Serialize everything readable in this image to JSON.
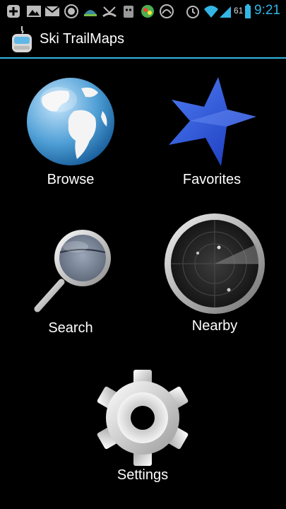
{
  "status_bar": {
    "notifications": [
      "add-icon",
      "image-icon",
      "gmail-icon",
      "sync-icon",
      "weather-icon",
      "missed-call-icon",
      "android-icon",
      "game-icon",
      "speed-icon"
    ],
    "battery_percent": "61",
    "time": "9:21"
  },
  "action_bar": {
    "title": "Ski TrailMaps"
  },
  "menu": {
    "browse": "Browse",
    "favorites": "Favorites",
    "search": "Search",
    "nearby": "Nearby",
    "settings": "Settings"
  },
  "colors": {
    "accent": "#33b5e5",
    "background": "#000000",
    "text": "#ffffff"
  }
}
